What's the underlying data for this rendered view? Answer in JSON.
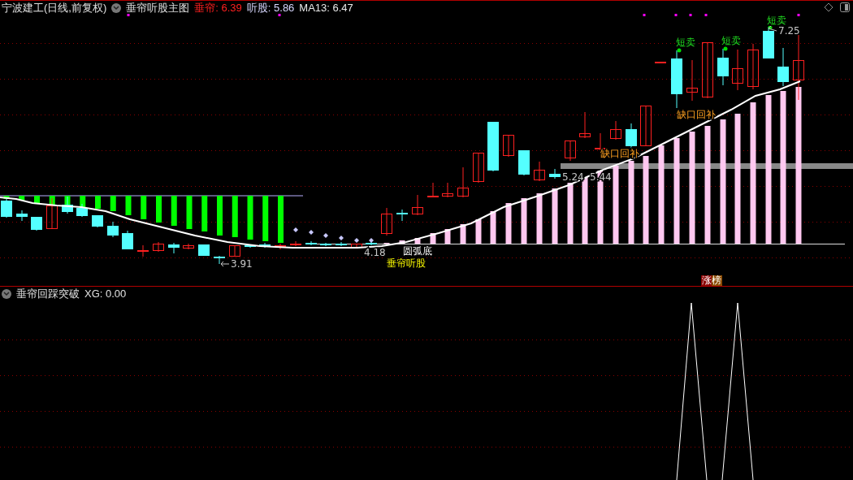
{
  "header": {
    "title": "宁波建工(日线,前复权)",
    "indicator": "垂帘听股主图",
    "readings": [
      {
        "label": "垂帘:",
        "value": "6.39",
        "color": "#ff2020"
      },
      {
        "label": "听股:",
        "value": "5.86",
        "color": "#d8d8ff"
      },
      {
        "label": "MA13:",
        "value": "6.47",
        "color": "#e8e8e8"
      }
    ]
  },
  "chart_labels": [
    {
      "kind": "signal",
      "text": "短卖"
    },
    {
      "kind": "signal",
      "text": "短卖"
    },
    {
      "kind": "signal",
      "text": "短卖"
    },
    {
      "kind": "price",
      "text": "7.25"
    },
    {
      "kind": "gap",
      "text": "缺口回补"
    },
    {
      "kind": "gap",
      "text": "缺口回补"
    },
    {
      "kind": "price",
      "text": "5.24"
    },
    {
      "kind": "price",
      "text": "5.44"
    },
    {
      "kind": "price",
      "text": "4.18"
    },
    {
      "kind": "buy",
      "text": "垂帘听股"
    },
    {
      "kind": "pattern",
      "text": "圆弧底"
    },
    {
      "kind": "price",
      "text": "3.91"
    }
  ],
  "badge": "涨榜",
  "lower_panel": {
    "indicator": "垂帘回踩突破",
    "readings": [
      {
        "label": "XG:",
        "value": "0.00"
      }
    ]
  }
}
